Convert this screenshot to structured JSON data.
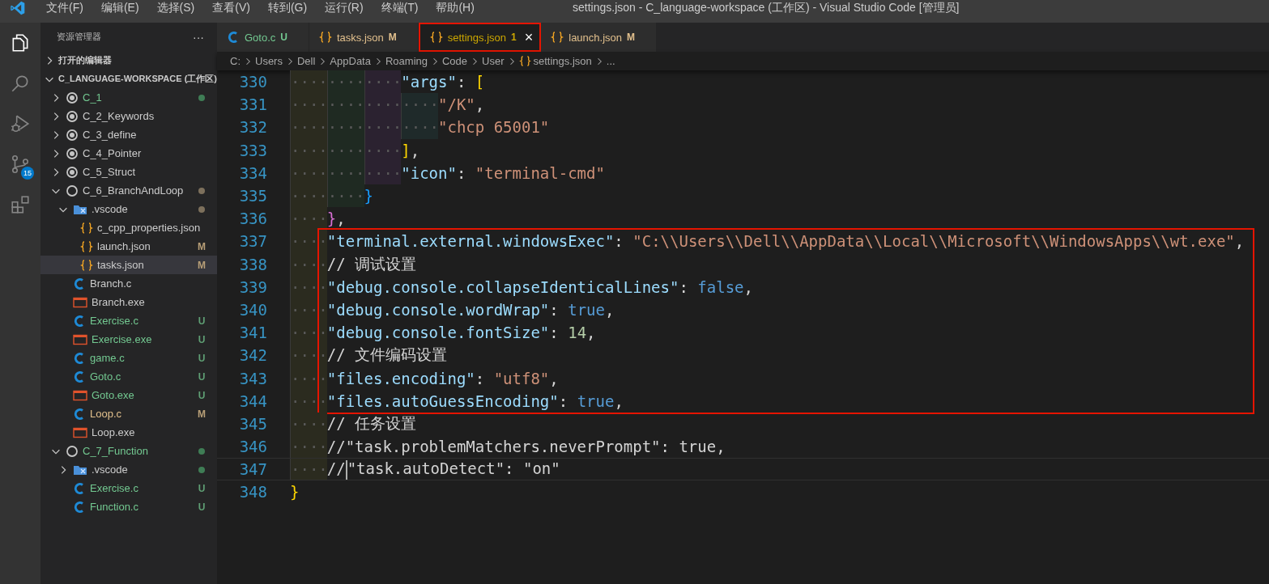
{
  "title_bar": {
    "menu": [
      "文件(F)",
      "编辑(E)",
      "选择(S)",
      "查看(V)",
      "转到(G)",
      "运行(R)",
      "终端(T)",
      "帮助(H)"
    ],
    "title": "settings.json - C_language-workspace (工作区) - Visual Studio Code [管理员]"
  },
  "activity_bar": [
    {
      "kind": "files",
      "selected": true
    },
    {
      "kind": "search",
      "selected": false
    },
    {
      "kind": "debug",
      "selected": false
    },
    {
      "kind": "scm",
      "selected": false,
      "badge": "15"
    },
    {
      "kind": "extensions",
      "selected": false
    }
  ],
  "explorer": {
    "title": "资源管理器",
    "more": "···",
    "sections": [
      {
        "label": "打开的编辑器",
        "expanded": false
      },
      {
        "label": "C_LANGUAGE-WORKSPACE (工作区)",
        "expanded": true,
        "children": [
          {
            "name": "C_1",
            "kind": "root",
            "expanded": false,
            "selected": false,
            "color": "#73c991",
            "dot": {
              "color": "#3f7d55"
            }
          },
          {
            "name": "C_2_Keywords",
            "kind": "root",
            "expanded": false,
            "selected": false,
            "color": "#cccccc"
          },
          {
            "name": "C_3_define",
            "kind": "root",
            "expanded": false,
            "selected": false,
            "color": "#cccccc"
          },
          {
            "name": "C_4_Pointer",
            "kind": "root",
            "expanded": false,
            "selected": false,
            "color": "#cccccc"
          },
          {
            "name": "C_5_Struct",
            "kind": "root",
            "expanded": false,
            "selected": false,
            "color": "#cccccc"
          },
          {
            "name": "C_6_BranchAndLoop",
            "kind": "root",
            "expanded": true,
            "selected": false,
            "color": "#cccccc",
            "dot": {
              "color": "#7d705c"
            },
            "children": [
              {
                "name": ".vscode",
                "kind": "folder",
                "expanded": true,
                "selected": false,
                "color": "#cccccc",
                "dot": {
                  "color": "#7d705c"
                },
                "children": [
                  {
                    "name": "c_cpp_properties.json",
                    "kind": "json",
                    "selected": false,
                    "color": "#cccccc"
                  },
                  {
                    "name": "launch.json",
                    "kind": "json",
                    "selected": false,
                    "color": "#cccccc",
                    "badge": {
                      "text": "M",
                      "color": "#b89f77"
                    }
                  },
                  {
                    "name": "tasks.json",
                    "kind": "json",
                    "selected": true,
                    "color": "#cccccc",
                    "badge": {
                      "text": "M",
                      "color": "#b89f77"
                    }
                  }
                ]
              },
              {
                "name": "Branch.c",
                "kind": "c",
                "selected": false,
                "color": "#cccccc"
              },
              {
                "name": "Branch.exe",
                "kind": "exe",
                "selected": false,
                "color": "#cccccc"
              },
              {
                "name": "Exercise.c",
                "kind": "c",
                "selected": false,
                "color": "#73c991",
                "badge": {
                  "text": "U",
                  "color": "#5f9f74"
                }
              },
              {
                "name": "Exercise.exe",
                "kind": "exe",
                "selected": false,
                "color": "#73c991",
                "badge": {
                  "text": "U",
                  "color": "#5f9f74"
                }
              },
              {
                "name": "game.c",
                "kind": "c",
                "selected": false,
                "color": "#73c991",
                "badge": {
                  "text": "U",
                  "color": "#5f9f74"
                }
              },
              {
                "name": "Goto.c",
                "kind": "c",
                "selected": false,
                "color": "#73c991",
                "badge": {
                  "text": "U",
                  "color": "#5f9f74"
                }
              },
              {
                "name": "Goto.exe",
                "kind": "exe",
                "selected": false,
                "color": "#73c991",
                "badge": {
                  "text": "U",
                  "color": "#5f9f74"
                }
              },
              {
                "name": "Loop.c",
                "kind": "c",
                "selected": false,
                "color": "#e2c08d",
                "badge": {
                  "text": "M",
                  "color": "#b89f77"
                }
              },
              {
                "name": "Loop.exe",
                "kind": "exe",
                "selected": false,
                "color": "#cccccc"
              }
            ]
          },
          {
            "name": "C_7_Function",
            "kind": "root",
            "expanded": true,
            "selected": false,
            "color": "#73c991",
            "dot": {
              "color": "#3f7d55"
            },
            "children": [
              {
                "name": ".vscode",
                "kind": "folder",
                "expanded": false,
                "selected": false,
                "color": "#cccccc",
                "dot": {
                  "color": "#3f7d55"
                }
              },
              {
                "name": "Exercise.c",
                "kind": "c",
                "selected": false,
                "color": "#73c991",
                "badge": {
                  "text": "U",
                  "color": "#5f9f74"
                }
              },
              {
                "name": "Function.c",
                "kind": "c",
                "selected": false,
                "color": "#73c991",
                "badge": {
                  "text": "U",
                  "color": "#5f9f74"
                }
              }
            ]
          }
        ]
      }
    ]
  },
  "tabs": [
    {
      "label": "Goto.c",
      "kind": "c",
      "status": "U",
      "color": "#73c991",
      "selected": false,
      "boxed": false
    },
    {
      "label": "tasks.json",
      "kind": "json",
      "status": "M",
      "color": "#e2c08d",
      "selected": false,
      "boxed": false
    },
    {
      "label": "settings.json",
      "kind": "json",
      "status": "1",
      "color": "#cca700",
      "selected": true,
      "boxed": true,
      "close": "×"
    },
    {
      "label": "launch.json",
      "kind": "json",
      "status": "M",
      "color": "#e2c08d",
      "selected": false,
      "boxed": false
    }
  ],
  "breadcrumbs": [
    {
      "label": "C:",
      "kind": "folder"
    },
    {
      "label": "Users",
      "kind": "folder"
    },
    {
      "label": "Dell",
      "kind": "folder"
    },
    {
      "label": "AppData",
      "kind": "folder"
    },
    {
      "label": "Roaming",
      "kind": "folder"
    },
    {
      "label": "Code",
      "kind": "folder"
    },
    {
      "label": "User",
      "kind": "folder"
    },
    {
      "label": "settings.json",
      "kind": "file"
    },
    {
      "label": "...",
      "kind": "symbol"
    }
  ],
  "editor": {
    "blocks": [
      {
        "boxed": false,
        "lines": [
          {
            "num": "330",
            "lead": "············",
            "tokens": [
              {
                "kind": "key",
                "text": "\"args\""
              },
              {
                "kind": "punct",
                "text": ": "
              },
              {
                "kind": "bracket",
                "text": "[",
                "color": "#ffd700"
              }
            ]
          },
          {
            "num": "331",
            "lead": "················",
            "tokens": [
              {
                "kind": "str",
                "text": "\"/K\""
              },
              {
                "kind": "punct",
                "text": ","
              }
            ]
          },
          {
            "num": "332",
            "lead": "················",
            "tokens": [
              {
                "kind": "str",
                "text": "\"chcp 65001\""
              }
            ]
          },
          {
            "num": "333",
            "lead": "············",
            "tokens": [
              {
                "kind": "bracket",
                "text": "]",
                "color": "#ffd700"
              },
              {
                "kind": "punct",
                "text": ","
              }
            ]
          },
          {
            "num": "334",
            "lead": "············",
            "tokens": [
              {
                "kind": "key",
                "text": "\"icon\""
              },
              {
                "kind": "punct",
                "text": ": "
              },
              {
                "kind": "str",
                "text": "\"terminal-cmd\""
              }
            ]
          },
          {
            "num": "335",
            "lead": "········",
            "tokens": [
              {
                "kind": "bracket",
                "text": "}",
                "color": "#179fff"
              }
            ]
          },
          {
            "num": "336",
            "lead": "····",
            "tokens": [
              {
                "kind": "bracket",
                "text": "}",
                "color": "#da70d6"
              },
              {
                "kind": "punct",
                "text": ","
              }
            ]
          }
        ]
      },
      {
        "boxed": true,
        "lines": [
          {
            "num": "337",
            "lead": "····",
            "tokens": [
              {
                "kind": "key",
                "text": "\"terminal.external.windowsExec\""
              },
              {
                "kind": "punct",
                "text": ": "
              },
              {
                "kind": "str",
                "text": "\"C:\\\\Users\\\\Dell\\\\AppData\\\\Local\\\\Microsoft\\\\WindowsApps\\\\wt.exe\""
              },
              {
                "kind": "punct",
                "text": ","
              }
            ]
          },
          {
            "num": "338",
            "lead": "····",
            "tokens": [
              {
                "kind": "comment",
                "text": "// 调试设置"
              }
            ]
          },
          {
            "num": "339",
            "lead": "····",
            "tokens": [
              {
                "kind": "key",
                "text": "\"debug.console.collapseIdenticalLines\""
              },
              {
                "kind": "punct",
                "text": ": "
              },
              {
                "kind": "kw",
                "text": "false"
              },
              {
                "kind": "punct",
                "text": ","
              }
            ]
          },
          {
            "num": "340",
            "lead": "····",
            "tokens": [
              {
                "kind": "key",
                "text": "\"debug.console.wordWrap\""
              },
              {
                "kind": "punct",
                "text": ": "
              },
              {
                "kind": "kw",
                "text": "true"
              },
              {
                "kind": "punct",
                "text": ","
              }
            ]
          },
          {
            "num": "341",
            "lead": "····",
            "tokens": [
              {
                "kind": "key",
                "text": "\"debug.console.fontSize\""
              },
              {
                "kind": "punct",
                "text": ": "
              },
              {
                "kind": "num",
                "text": "14"
              },
              {
                "kind": "punct",
                "text": ","
              }
            ]
          },
          {
            "num": "342",
            "lead": "····",
            "tokens": [
              {
                "kind": "comment",
                "text": "// 文件编码设置"
              }
            ]
          },
          {
            "num": "343",
            "lead": "····",
            "tokens": [
              {
                "kind": "key",
                "text": "\"files.encoding\""
              },
              {
                "kind": "punct",
                "text": ": "
              },
              {
                "kind": "str",
                "text": "\"utf8\""
              },
              {
                "kind": "punct",
                "text": ","
              }
            ]
          },
          {
            "num": "344",
            "lead": "····",
            "tokens": [
              {
                "kind": "key",
                "text": "\"files.autoGuessEncoding\""
              },
              {
                "kind": "punct",
                "text": ": "
              },
              {
                "kind": "kw",
                "text": "true"
              },
              {
                "kind": "punct",
                "text": ","
              }
            ]
          }
        ]
      },
      {
        "boxed": false,
        "lines": [
          {
            "num": "345",
            "lead": "····",
            "tokens": [
              {
                "kind": "comment",
                "text": "// 任务设置"
              }
            ]
          },
          {
            "num": "346",
            "lead": "····",
            "tokens": [
              {
                "kind": "comment",
                "text": "//\"task.problemMatchers.neverPrompt\": true,"
              }
            ]
          },
          {
            "num": "347",
            "lead": "····",
            "current": true,
            "tokens": [
              {
                "kind": "comment",
                "text": "//",
                "caret": true
              },
              {
                "kind": "comment",
                "text": "\"task.autoDetect\": \"on\""
              }
            ]
          },
          {
            "num": "348",
            "tokens": [
              {
                "kind": "bracket",
                "text": "}",
                "color": "#ffd700"
              }
            ]
          }
        ]
      }
    ]
  }
}
